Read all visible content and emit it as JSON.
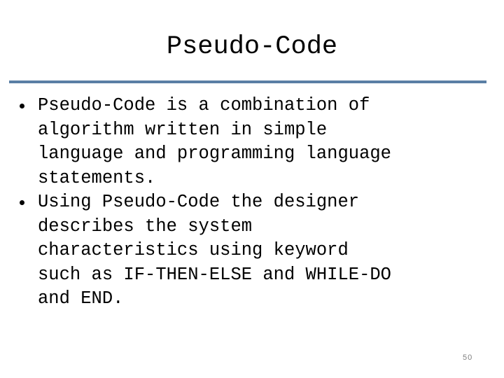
{
  "slide": {
    "title": "Pseudo-Code",
    "accent_color": "#5a7fa5",
    "bullets": [
      {
        "lines": [
          "Pseudo-Code is a combination of",
          "algorithm written in simple",
          "language and programming language",
          "statements."
        ]
      },
      {
        "lines": [
          "Using Pseudo-Code the designer",
          "describes the system",
          "characteristics using keyword",
          "such as IF-THEN-ELSE and WHILE-DO",
          "and END."
        ]
      }
    ],
    "page_number": "50"
  }
}
